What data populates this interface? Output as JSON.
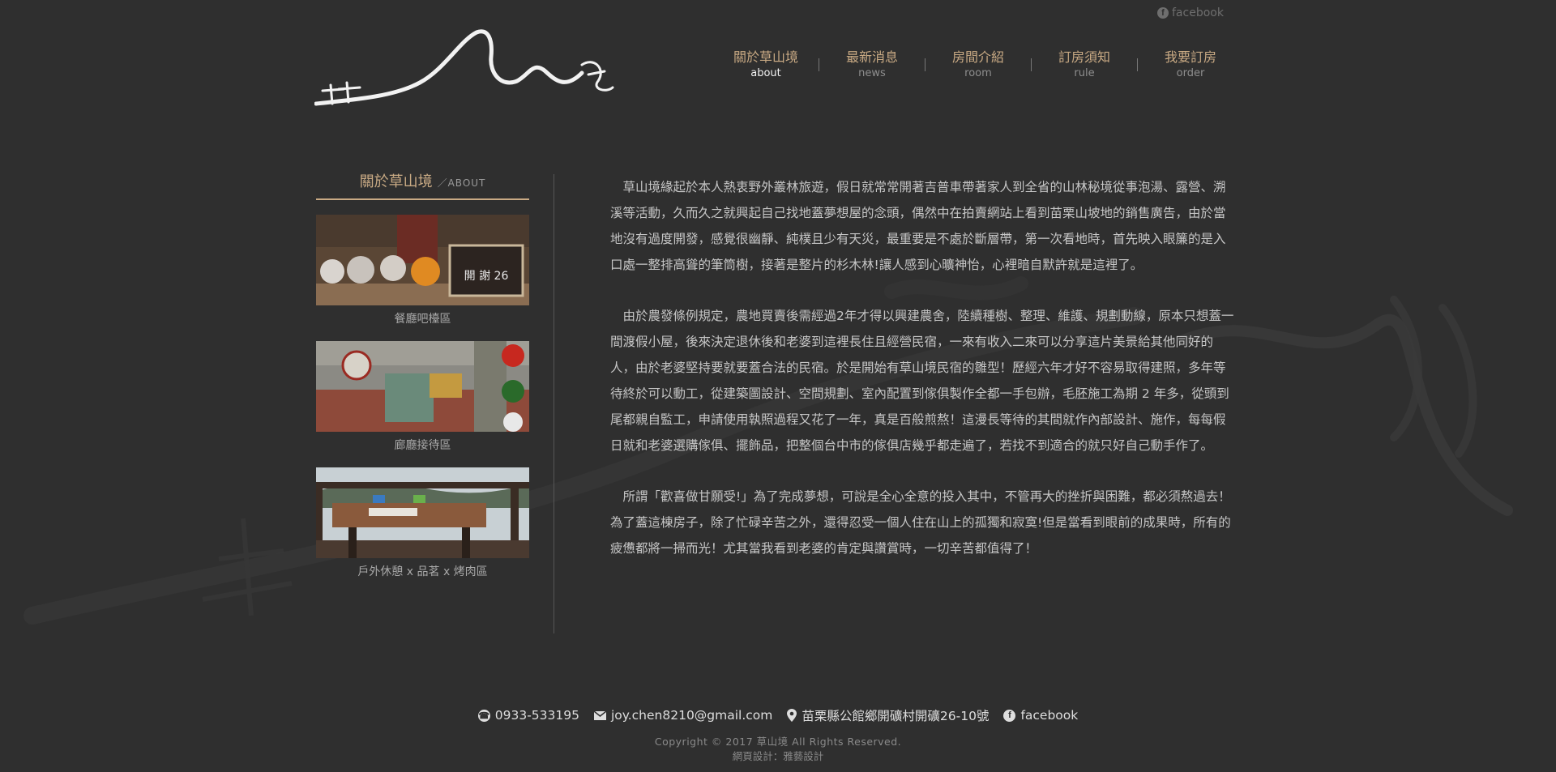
{
  "header": {
    "social_label": "facebook",
    "nav": [
      {
        "zh": "關於草山境",
        "en": "about",
        "active": true
      },
      {
        "zh": "最新消息",
        "en": "news",
        "active": false
      },
      {
        "zh": "房間介紹",
        "en": "room",
        "active": false
      },
      {
        "zh": "訂房須知",
        "en": "rule",
        "active": false
      },
      {
        "zh": "我要訂房",
        "en": "order",
        "active": false
      }
    ]
  },
  "sidebar": {
    "title_zh": "關於草山境",
    "title_en": "／ABOUT",
    "thumbs": [
      {
        "caption": "餐廳吧檯區",
        "sign_text": "開 謝 26"
      },
      {
        "caption": "廊廳接待區"
      },
      {
        "caption": "戶外休憩 x 品茗 x 烤肉區"
      }
    ]
  },
  "content": {
    "paragraphs": [
      "草山境緣起於本人熱衷野外叢林旅遊，假日就常常開著吉普車帶著家人到全省的山林秘境從事泡湯、露營、溯溪等活動，久而久之就興起自己找地蓋夢想屋的念頭，偶然中在拍賣網站上看到苗栗山坡地的銷售廣告，由於當地沒有過度開發，感覺很幽靜、純樸且少有天災，最重要是不處於斷層帶，第一次看地時，首先映入眼簾的是入口處一整排高聳的筆筒樹，接著是整片的杉木林!讓人感到心曠神怡，心裡暗自默許就是這裡了。",
      "由於農發條例規定，農地買賣後需經過2年才得以興建農舍，陸續種樹、整理、維護、規劃動線，原本只想蓋一間渡假小屋，後來決定退休後和老婆到這裡長住且經營民宿，一來有收入二來可以分享這片美景給其他同好的人，由於老婆堅持要就要蓋合法的民宿。於是開始有草山境民宿的雛型！歷經六年才好不容易取得建照，多年等待終於可以動工，從建築圖設計、空間規劃、室內配置到傢俱製作全都一手包辦，毛胚施工為期 2 年多，從頭到尾都親自監工，申請使用執照過程又花了一年，真是百般煎熬！這漫長等待的其間就作內部設計、施作，每每假日就和老婆選購傢俱、擺飾品，把整個台中市的傢俱店幾乎都走遍了，若找不到適合的就只好自己動手作了。",
      "所謂「歡喜做甘願受!」為了完成夢想，可說是全心全意的投入其中，不管再大的挫折與困難，都必須熬過去！為了蓋這棟房子，除了忙碌辛苦之外，還得忍受一個人住在山上的孤獨和寂寞!但是當看到眼前的成果時，所有的疲憊都將一掃而光！尤其當我看到老婆的肯定與讚賞時，一切辛苦都值得了！"
    ]
  },
  "footer": {
    "phone": "0933-533195",
    "email": "joy.chen8210@gmail.com",
    "address": "苗栗縣公館鄉開礦村開礦26-10號",
    "facebook": "facebook",
    "copyright": "Copyright © 2017 草山境 All Rights Reserved.",
    "credit": "網頁設計：雅藝設計"
  },
  "colors": {
    "background": "#2f2f2f",
    "accent": "#c9aa84",
    "body_text": "#c6c6c6"
  },
  "icons": {
    "top_social": "facebook-icon",
    "phone": "phone-icon",
    "email": "envelope-icon",
    "address": "map-pin-icon",
    "facebook": "facebook-icon"
  }
}
